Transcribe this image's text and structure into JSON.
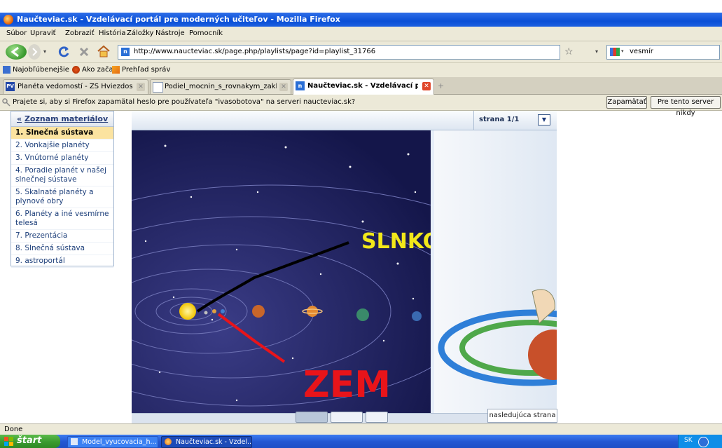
{
  "window": {
    "title": "Naučteviac.sk - Vzdelávací portál pre moderných učiteľov - Mozilla Firefox"
  },
  "menu": [
    "Súbor",
    "Upraviť",
    "Zobraziť",
    "História",
    "Záložky",
    "Nástroje",
    "Pomocník"
  ],
  "nav": {
    "url": "http://www.naucteviac.sk/page.php/playlists/page?id=playlist_31766",
    "search_value": "vesmír"
  },
  "bookmarks": [
    "Najobľúbenejšie",
    "Ako začať",
    "Prehľad správ"
  ],
  "tabs": [
    {
      "label": "Planéta vedomostí - ZŠ Hviezdoslavova..."
    },
    {
      "label": "Podiel_mocnin_s_rovnakym_zakladom...."
    },
    {
      "label": "Naučteviac.sk - Vzdelávací portál..."
    }
  ],
  "notification": {
    "message": "Prajete si, aby si Firefox zapamätal heslo pre používateľa \"ivasobotova\" na serveri naucteviac.sk?",
    "remember_label": "Zapamätať",
    "never_label": "Pre tento server nikdy"
  },
  "sidebar": {
    "header": "Zoznam materiálov",
    "back_glyph": "«",
    "items": [
      {
        "label": "1. Slnečná sústava"
      },
      {
        "label": "2. Vonkajšie planéty"
      },
      {
        "label": "3. Vnútorné planéty"
      },
      {
        "label": "4. Poradie planét v našej slnečnej sústave"
      },
      {
        "label": "5. Skalnaté planéty a plynové obry"
      },
      {
        "label": "6. Planéty a iné vesmírne telesá"
      },
      {
        "label": "7. Prezentácia"
      },
      {
        "label": "8. Slnečná sústava"
      },
      {
        "label": "9. astroportál"
      }
    ]
  },
  "viewer": {
    "page_label": "strana 1/1",
    "next_page_label": "nasledujúca strana",
    "annotations": {
      "sun": "SLNKO",
      "earth": "ZEM"
    }
  },
  "status": {
    "text": "Done"
  },
  "taskbar": {
    "start_label": "štart",
    "items": [
      {
        "label": "Model_vyucovacia_h..."
      },
      {
        "label": "Naučteviac.sk - Vzdel..."
      }
    ],
    "lang": "SK"
  },
  "colors": {
    "titlebar": "#0a4fd6",
    "selected_item": "#fbe3a0",
    "space_bg": "#14164a",
    "annotation_yellow": "#f2e81a",
    "annotation_red": "#e8141a"
  }
}
